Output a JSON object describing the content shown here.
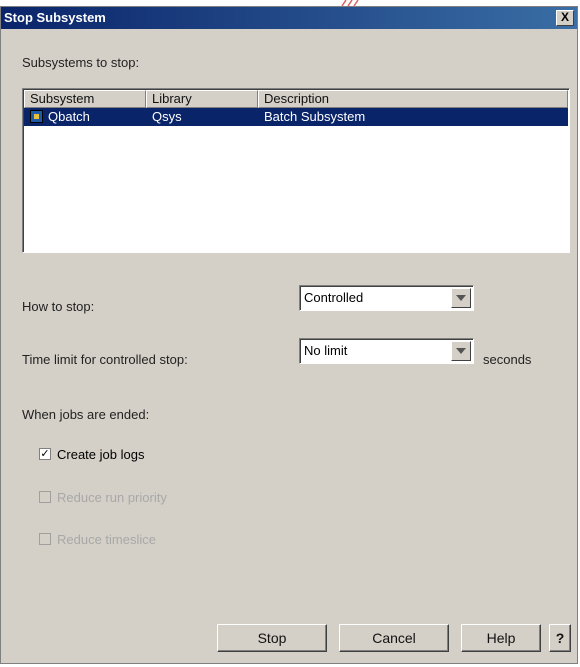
{
  "window": {
    "title": "Stop Subsystem",
    "close_label": "X"
  },
  "subsystems_label": "Subsystems to stop:",
  "table": {
    "headers": [
      "Subsystem",
      "Library",
      "Description"
    ],
    "rows": [
      {
        "subsystem": "Qbatch",
        "library": "Qsys",
        "description": "Batch Subsystem",
        "icon": "subsystem-icon"
      }
    ]
  },
  "how_to_stop": {
    "label": "How to stop:",
    "value": "Controlled"
  },
  "time_limit": {
    "label": "Time limit for controlled stop:",
    "value": "No limit",
    "unit": "seconds"
  },
  "jobs_ended_label": "When jobs are ended:",
  "options": [
    {
      "label": "Create job logs",
      "checked": true,
      "enabled": true,
      "mark": "✓"
    },
    {
      "label": "Reduce run priority",
      "checked": false,
      "enabled": false
    },
    {
      "label": "Reduce timeslice",
      "checked": false,
      "enabled": false
    }
  ],
  "buttons": {
    "stop": "Stop",
    "cancel": "Cancel",
    "help": "Help",
    "what": "?"
  },
  "colors": {
    "selection": "#0a246a",
    "dialog_bg": "#d4d0c8",
    "balloon": "#f5b840"
  }
}
